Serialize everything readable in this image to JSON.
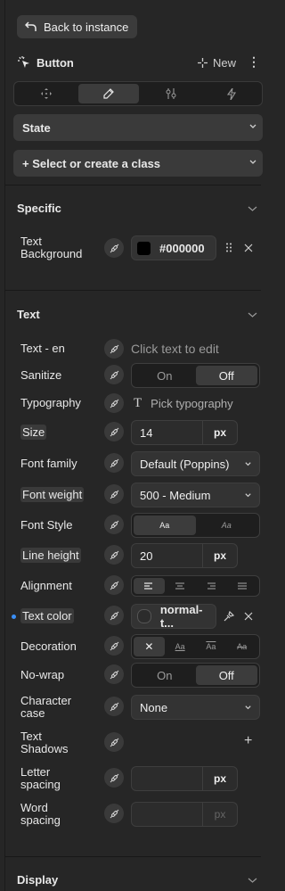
{
  "header": {
    "back_label": "Back to instance",
    "element_name": "Button",
    "new_label": "New",
    "more_label": "⋮"
  },
  "tabs": [
    {
      "icon": "move-icon",
      "active": false
    },
    {
      "icon": "pencil-icon",
      "active": true
    },
    {
      "icon": "sliders-icon",
      "active": false
    },
    {
      "icon": "lightning-icon",
      "active": false
    }
  ],
  "state_dropdown": {
    "value": "State"
  },
  "class_selector": {
    "label": "+ Select or create a class"
  },
  "sections": {
    "specific": "Specific",
    "text": "Text",
    "display": "Display"
  },
  "specific": {
    "text_background": {
      "label": "Text Background",
      "color_value": "#000000",
      "swatch": "#000000"
    }
  },
  "text": {
    "text_en": {
      "label": "Text - en",
      "placeholder": "Click text to edit"
    },
    "sanitize": {
      "label": "Sanitize",
      "options": [
        "On",
        "Off"
      ],
      "selected": "Off"
    },
    "typography": {
      "label": "Typography",
      "value": "Pick typography"
    },
    "size": {
      "label": "Size",
      "value": "14",
      "unit": "px"
    },
    "font_family": {
      "label": "Font family",
      "value": "Default (Poppins)"
    },
    "font_weight": {
      "label": "Font weight",
      "value": "500 - Medium"
    },
    "font_style": {
      "label": "Font Style",
      "options": [
        "Aa",
        "Aa"
      ]
    },
    "line_height": {
      "label": "Line height",
      "value": "20",
      "unit": "px"
    },
    "alignment": {
      "label": "Alignment"
    },
    "text_color": {
      "label": "Text color",
      "value": "normal-t...",
      "swatch": "#2c2c2c"
    },
    "decoration": {
      "label": "Decoration",
      "options": [
        "✕",
        "Aa",
        "Aa",
        "Aa"
      ]
    },
    "no_wrap": {
      "label": "No-wrap",
      "options": [
        "On",
        "Off"
      ],
      "selected": "Off"
    },
    "character_case": {
      "label": "Character case",
      "value": "None"
    },
    "text_shadows": {
      "label": "Text Shadows",
      "add_label": "+"
    },
    "letter_spacing": {
      "label": "Letter spacing",
      "value": "",
      "unit": "px"
    },
    "word_spacing": {
      "label": "Word spacing",
      "value": "",
      "unit": "px"
    }
  },
  "colors": {
    "accent": "#3a8ef6",
    "background": "#262626"
  }
}
